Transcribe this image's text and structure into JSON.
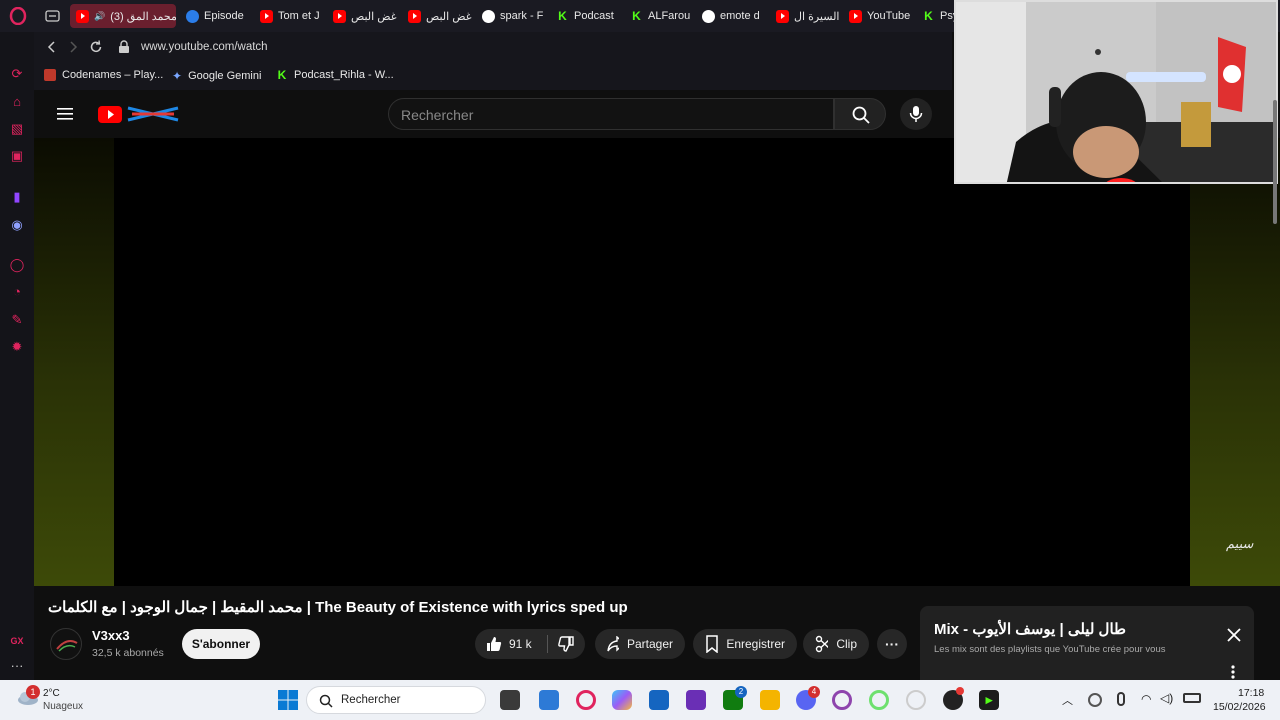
{
  "tabs": [
    {
      "label": "(3) محمد المق",
      "type": "youtube",
      "active": true
    },
    {
      "label": "Episode",
      "type": "episode"
    },
    {
      "label": "Tom et J",
      "type": "youtube"
    },
    {
      "label": "غض البص",
      "type": "youtube"
    },
    {
      "label": "غض البص",
      "type": "youtube"
    },
    {
      "label": "spark - F",
      "type": "google"
    },
    {
      "label": "Podcast",
      "type": "kick"
    },
    {
      "label": "ALFarou",
      "type": "kick"
    },
    {
      "label": "emote d",
      "type": "google"
    },
    {
      "label": "السيرة ال",
      "type": "youtube"
    },
    {
      "label": "YouTube",
      "type": "youtube"
    },
    {
      "label": "Psy",
      "type": "kick"
    }
  ],
  "address": {
    "url": "www.youtube.com/watch"
  },
  "bookmarks": [
    {
      "label": "Codenames – Play...",
      "icon": "codenames-icon"
    },
    {
      "label": "Google Gemini",
      "icon": "gemini-icon"
    },
    {
      "label": "Podcast_Rihla - W...",
      "icon": "kick-icon"
    }
  ],
  "search": {
    "placeholder": "Rechercher"
  },
  "video": {
    "title": "محمد المقيط | جمال الوجود | مع الكلمات | The Beauty of Existence with lyrics sped up",
    "watermark": "ﺳﯿﯿﻢ"
  },
  "channel": {
    "name": "V3xx3",
    "subscribers": "32,5 k abonnés",
    "subscribe_label": "S'abonner"
  },
  "actions": {
    "likes": "91 k",
    "share": "Partager",
    "save": "Enregistrer",
    "clip": "Clip"
  },
  "mix": {
    "title": "Mix - طال ليلى | يوسف الأيوب",
    "subtitle": "Les mix sont des playlists que YouTube crée pour vous"
  },
  "sidebar_badge": "GX",
  "taskbar": {
    "weather_temp": "2°C",
    "weather_desc": "Nuageux",
    "weather_badge": "1",
    "search_label": "Rechercher",
    "time": "17:18",
    "date": "15/02/2026",
    "xbox_badge": "2",
    "discord_badge": "4"
  },
  "colors": {
    "opera_red": "#e0245e",
    "youtube_red": "#ff0000",
    "kick_green": "#53fc18",
    "ambient_olive": "#3d4a08"
  }
}
